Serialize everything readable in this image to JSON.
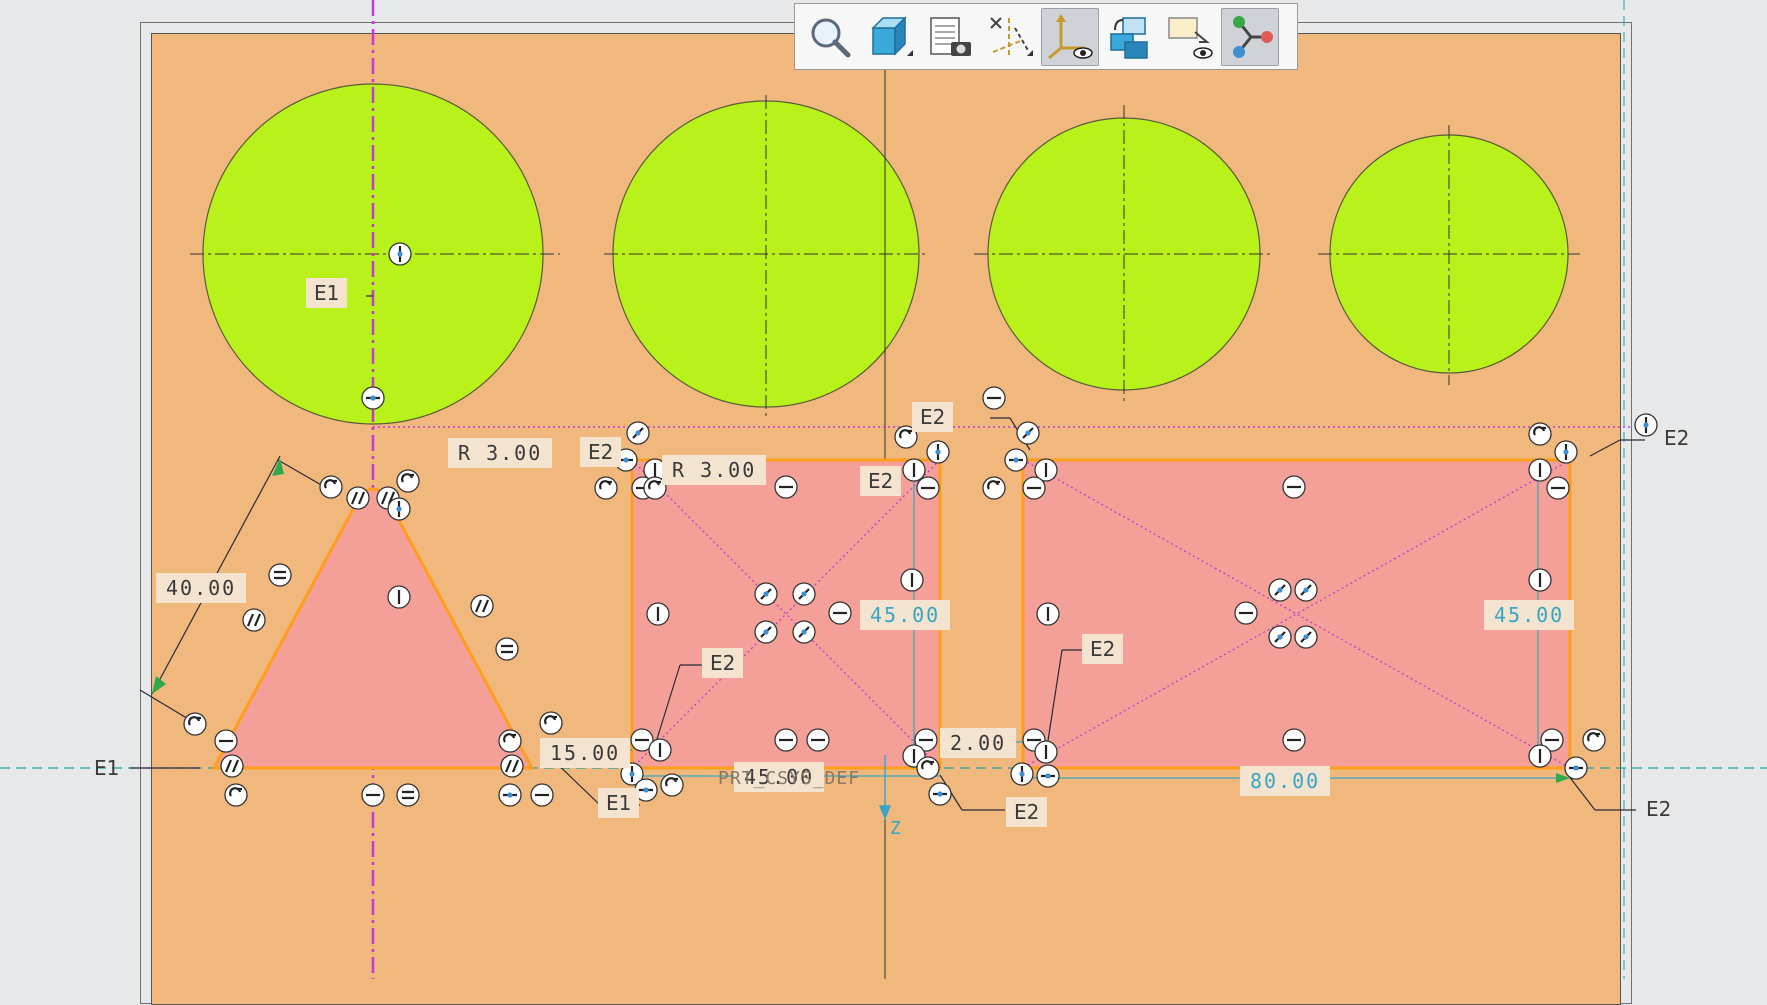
{
  "toolbar": {
    "buttons": [
      {
        "id": "zoom",
        "icon": "magnifier-zoom-icon",
        "active": false
      },
      {
        "id": "view",
        "icon": "saved-view-cube-icon",
        "active": false
      },
      {
        "id": "display",
        "icon": "sheet-camera-icon",
        "active": false
      },
      {
        "id": "datum",
        "icon": "datum-display-icon",
        "active": false
      },
      {
        "id": "csys",
        "icon": "coordinate-system-display-icon",
        "active": true
      },
      {
        "id": "orient",
        "icon": "reorient-copy-icon",
        "active": false
      },
      {
        "id": "annotation",
        "icon": "annotation-display-icon",
        "active": false
      },
      {
        "id": "sketch",
        "icon": "sketcher-display-icon",
        "active": true
      }
    ]
  },
  "colors": {
    "sheet": "#f0b87c",
    "circle_fill": "#b8f21a",
    "shape_fill": "#f4a098",
    "shape_stroke": "#ff9e1a",
    "dimension_blue": "#37a6c4",
    "constraint_magenta": "#c23bd6"
  },
  "dimensions": {
    "r_left": "R 3.00",
    "r_mid": "R 3.00",
    "len_40": "40.00",
    "len_15": "15.00",
    "len_45_bottom": "45.00",
    "len_45_mid": "45.00",
    "len_45_right": "45.00",
    "len_2": "2.00",
    "len_80": "80.00"
  },
  "labels": {
    "e1_circle": "E1",
    "e1_axis": "E1",
    "e1_bottom": "E1",
    "e2_a": "E2",
    "e2_b": "E2",
    "e2_c": "E2",
    "e2_d": "E2",
    "e2_e": "E2",
    "e2_f": "E2",
    "e2_g": "E2",
    "e2_h": "E2"
  },
  "notes": {
    "prt_def": "PRT_CSYS_DEF",
    "axis_z": "Z"
  }
}
